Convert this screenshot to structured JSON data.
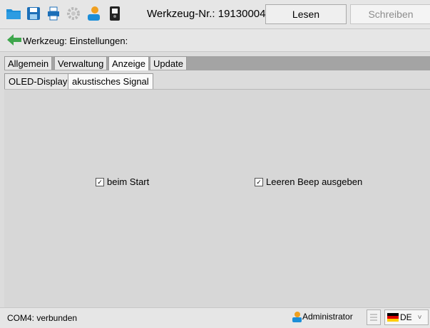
{
  "toolbar": {
    "icons": [
      "open-folder-icon",
      "save-disk-icon",
      "print-icon",
      "settings-gear-icon",
      "user-icon",
      "device-icon"
    ],
    "tool_label": "Werkzeug-Nr.: 19130004",
    "read_label": "Lesen",
    "write_label": "Schreiben"
  },
  "breadcrumb": {
    "label": "Werkzeug: Einstellungen:"
  },
  "tabs": [
    {
      "label": "Allgemein"
    },
    {
      "label": "Verwaltung"
    },
    {
      "label": "Anzeige"
    },
    {
      "label": "Update"
    }
  ],
  "subtabs": [
    {
      "label": "OLED-Display"
    },
    {
      "label": "akustisches Signal"
    }
  ],
  "settings": {
    "start": {
      "label": "beim Start",
      "checked": true
    },
    "empty_beep": {
      "label": "Leeren Beep ausgeben",
      "checked": true
    }
  },
  "status": {
    "connection": "COM4: verbunden",
    "user": "Administrator",
    "language": "DE"
  },
  "colors": {
    "toolbar_blue": "#1c8ed8",
    "back_green": "#3ea64c"
  }
}
